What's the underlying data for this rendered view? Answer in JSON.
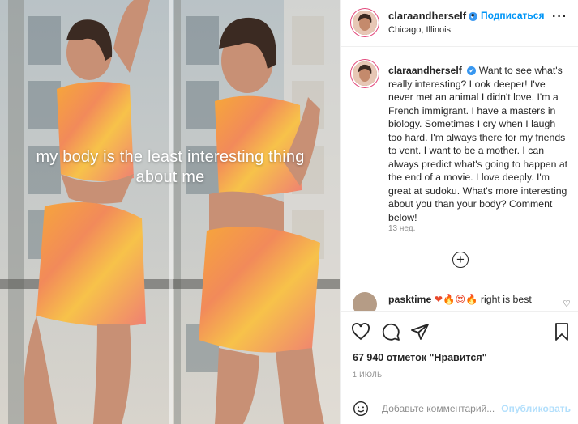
{
  "photo": {
    "caption_line1": "my body is the least interesting thing",
    "caption_line2": "about me"
  },
  "header": {
    "username": "claraandherself",
    "verified_mark": "✔",
    "separator": "•",
    "follow_label": "Подписаться",
    "location": "Chicago, Illinois",
    "more_label": "···"
  },
  "caption": {
    "username": "claraandherself",
    "text": "Want to see what's really interesting? Look deeper! I've never met an animal I didn't love. I'm a French immigrant. I have a masters in biology. Sometimes I cry when I laugh too hard. I'm always there for my friends to vent. I want to be a mother. I can always predict what's going to happen at the end of a movie. I love deeply. I'm great at sudoku. What's more interesting about you than your body? Comment below!",
    "time": "13 нед.",
    "load_more_symbol": "+"
  },
  "comment": {
    "username": "pasktime",
    "emoji": "❤🔥😍🔥",
    "text": "right is best",
    "like_symbol": "♡"
  },
  "actions": {
    "likes": "67 940 отметок \"Нравится\"",
    "date": "1 ИЮЛЬ"
  },
  "add_comment": {
    "placeholder": "Добавьте комментарий...",
    "publish_label": "Опубликовать"
  },
  "colors": {
    "accent": "#0095f6",
    "story_ring": "#e2497c",
    "muted": "#8e8e8e"
  }
}
